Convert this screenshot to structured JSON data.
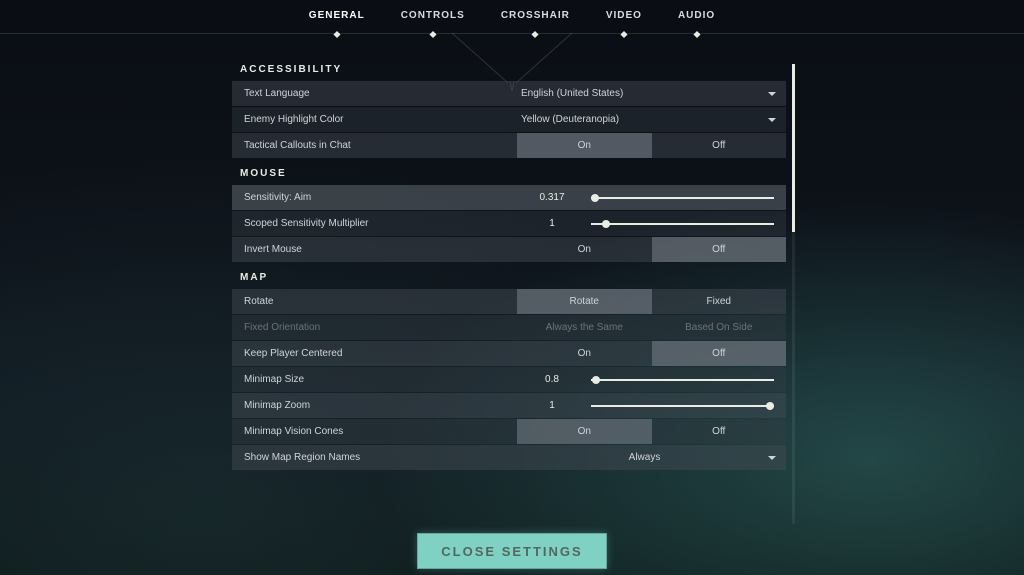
{
  "nav": {
    "tabs": [
      {
        "label": "GENERAL",
        "active": true
      },
      {
        "label": "CONTROLS",
        "active": false
      },
      {
        "label": "CROSSHAIR",
        "active": false
      },
      {
        "label": "VIDEO",
        "active": false
      },
      {
        "label": "AUDIO",
        "active": false
      }
    ]
  },
  "sections": {
    "accessibility": {
      "title": "ACCESSIBILITY",
      "text_language": {
        "label": "Text Language",
        "value": "English (United States)"
      },
      "enemy_highlight": {
        "label": "Enemy Highlight Color",
        "value": "Yellow (Deuteranopia)"
      },
      "tactical_callouts": {
        "label": "Tactical Callouts in Chat",
        "on": "On",
        "off": "Off",
        "selected": "on"
      }
    },
    "mouse": {
      "title": "MOUSE",
      "sensitivity": {
        "label": "Sensitivity: Aim",
        "value": "0.317",
        "pos": 2
      },
      "scoped_mult": {
        "label": "Scoped Sensitivity Multiplier",
        "value": "1",
        "pos": 8
      },
      "invert": {
        "label": "Invert Mouse",
        "on": "On",
        "off": "Off",
        "selected": "off"
      }
    },
    "map": {
      "title": "MAP",
      "rotate": {
        "label": "Rotate",
        "a": "Rotate",
        "b": "Fixed",
        "selected": "a"
      },
      "fixed_orientation": {
        "label": "Fixed Orientation",
        "a": "Always the Same",
        "b": "Based On Side"
      },
      "keep_centered": {
        "label": "Keep Player Centered",
        "on": "On",
        "off": "Off",
        "selected": "off"
      },
      "minimap_size": {
        "label": "Minimap Size",
        "value": "0.8",
        "pos": 3
      },
      "minimap_zoom": {
        "label": "Minimap Zoom",
        "value": "1",
        "pos": 98
      },
      "vision_cones": {
        "label": "Minimap Vision Cones",
        "on": "On",
        "off": "Off",
        "selected": "on"
      },
      "region_names": {
        "label": "Show Map Region Names",
        "value": "Always"
      }
    }
  },
  "close_label": "CLOSE SETTINGS"
}
